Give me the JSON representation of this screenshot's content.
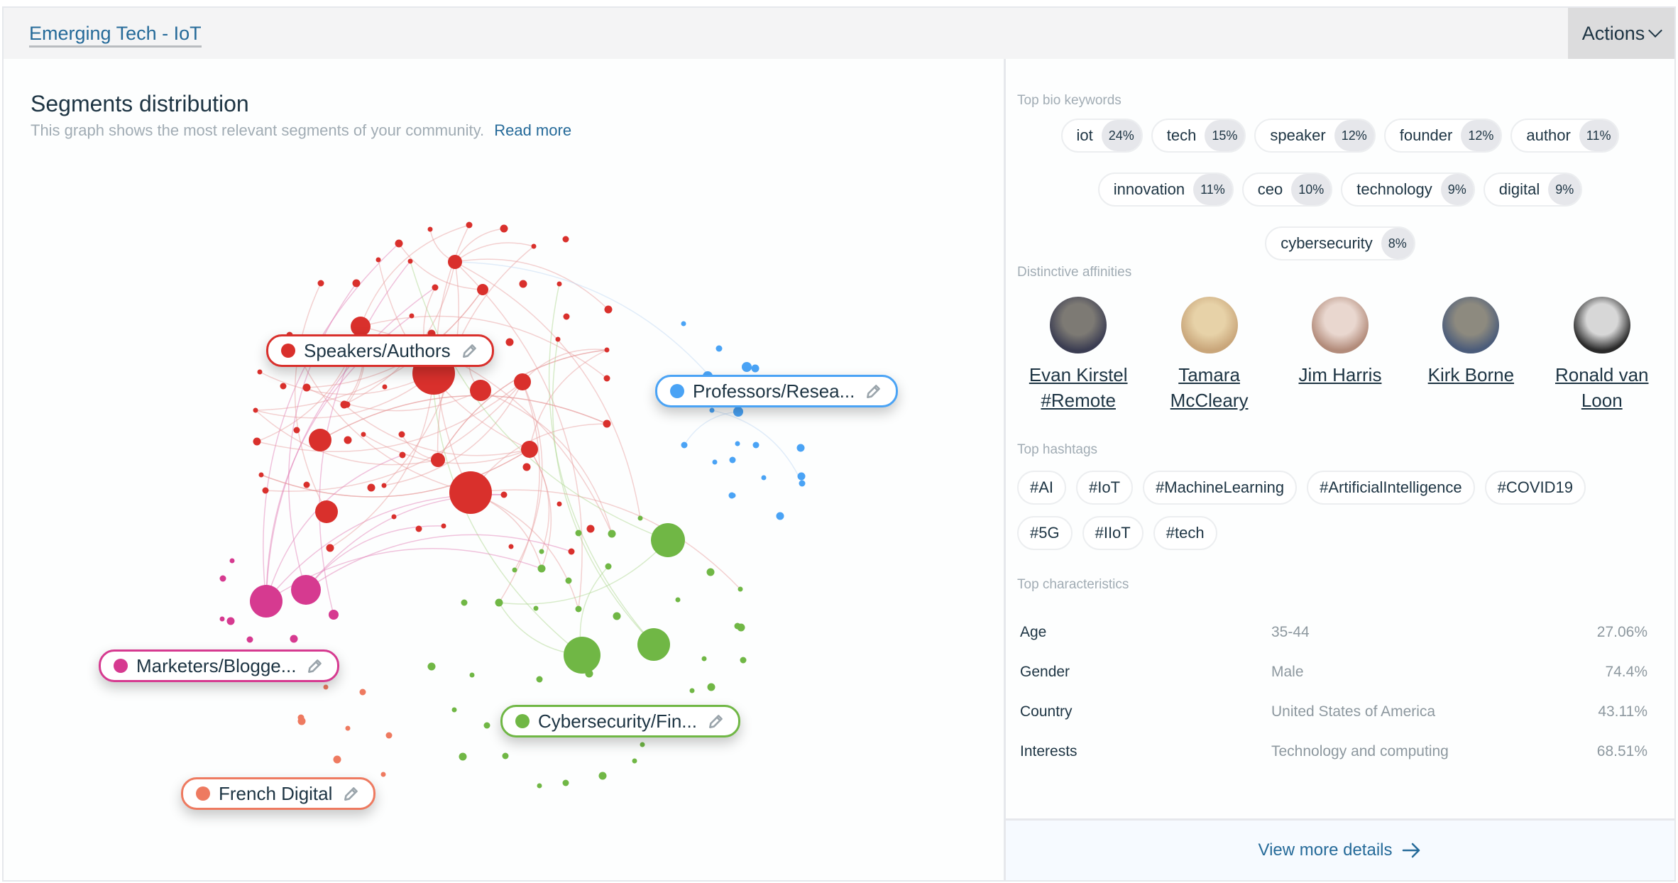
{
  "header": {
    "title": "Emerging Tech - IoT",
    "actions_label": "Actions"
  },
  "segments": {
    "title": "Segments distribution",
    "subtitle": "This graph shows the most relevant segments of your community.",
    "read_more": "Read more",
    "groups": [
      {
        "id": "speakers",
        "label": "Speakers/Authors",
        "color": "#d9302c"
      },
      {
        "id": "professors",
        "label": "Professors/Resea...",
        "color": "#4aa3f5"
      },
      {
        "id": "marketers",
        "label": "Marketers/Blogge...",
        "color": "#d63a90"
      },
      {
        "id": "cyber",
        "label": "Cybersecurity/Fin...",
        "color": "#70b745"
      },
      {
        "id": "french",
        "label": "French Digital",
        "color": "#ee7a60"
      }
    ]
  },
  "sidebar": {
    "bio_keywords_label": "Top bio keywords",
    "bio_keywords": [
      {
        "keyword": "iot",
        "pct": "24%"
      },
      {
        "keyword": "tech",
        "pct": "15%"
      },
      {
        "keyword": "speaker",
        "pct": "12%"
      },
      {
        "keyword": "founder",
        "pct": "12%"
      },
      {
        "keyword": "author",
        "pct": "11%"
      },
      {
        "keyword": "innovation",
        "pct": "11%"
      },
      {
        "keyword": "ceo",
        "pct": "10%"
      },
      {
        "keyword": "technology",
        "pct": "9%"
      },
      {
        "keyword": "digital",
        "pct": "9%"
      },
      {
        "keyword": "cybersecurity",
        "pct": "8%"
      }
    ],
    "affinities_label": "Distinctive affinities",
    "affinities": [
      {
        "name": "Evan Kirstel #Remote"
      },
      {
        "name": "Tamara McCleary"
      },
      {
        "name": "Jim Harris"
      },
      {
        "name": "Kirk Borne"
      },
      {
        "name": "Ronald van Loon"
      }
    ],
    "hashtags_label": "Top hashtags",
    "hashtags": [
      "#AI",
      "#IoT",
      "#MachineLearning",
      "#ArtificialIntelligence",
      "#COVID19",
      "#5G",
      "#IIoT",
      "#tech"
    ],
    "characteristics_label": "Top characteristics",
    "characteristics": [
      {
        "name": "Age",
        "value": "35-44",
        "pct": "27.06%"
      },
      {
        "name": "Gender",
        "value": "Male",
        "pct": "74.4%"
      },
      {
        "name": "Country",
        "value": "United States of America",
        "pct": "43.11%"
      },
      {
        "name": "Interests",
        "value": "Technology and computing",
        "pct": "68.51%"
      }
    ],
    "view_more": "View more details"
  }
}
